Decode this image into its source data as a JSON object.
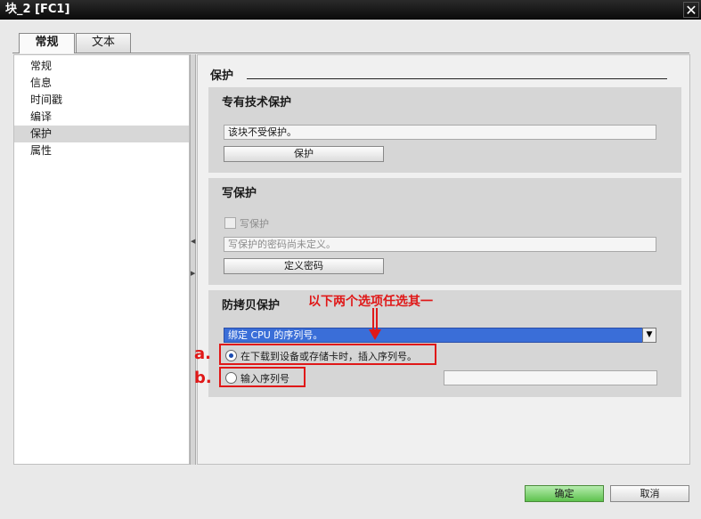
{
  "window": {
    "title": "块_2 [FC1]",
    "close_glyph": "✕"
  },
  "tabs": [
    {
      "label": "常规"
    },
    {
      "label": "文本"
    }
  ],
  "nav": {
    "items": [
      "常规",
      "信息",
      "时间戳",
      "编译",
      "保护",
      "属性"
    ],
    "selected": "保护"
  },
  "section": {
    "title": "保护"
  },
  "know_how": {
    "title": "专有技术保护",
    "status": "该块不受保护。",
    "button": "保护"
  },
  "write_protect": {
    "title": "写保护",
    "checkbox_label": "写保护",
    "status": "写保护的密码尚未定义。",
    "button": "定义密码"
  },
  "copy_protect": {
    "title": "防拷贝保护",
    "dropdown_value": "绑定 CPU 的序列号。",
    "option_a": "在下载到设备或存储卡时，插入序列号。",
    "option_b": "输入序列号"
  },
  "annotations": {
    "note": "以下两个选项任选其一",
    "a": "a.",
    "b": "b."
  },
  "footer": {
    "ok": "确定",
    "cancel": "取消"
  },
  "colors": {
    "accent_red": "#e01818",
    "dropdown_blue": "#3a6ed8",
    "ok_green": "#5ec24e"
  }
}
